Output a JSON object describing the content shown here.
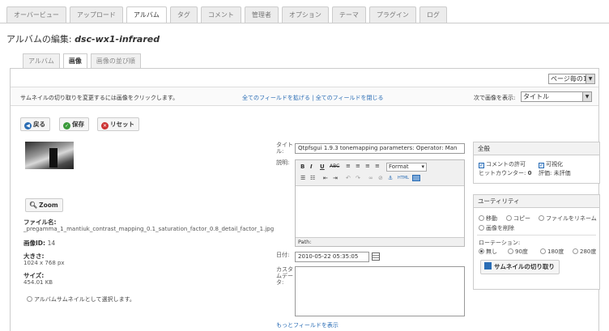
{
  "main_tabs": [
    {
      "label": "オーバービュー"
    },
    {
      "label": "アップロード"
    },
    {
      "label": "アルバム"
    },
    {
      "label": "タグ"
    },
    {
      "label": "コメント"
    },
    {
      "label": "管理者"
    },
    {
      "label": "オプション"
    },
    {
      "label": "テーマ"
    },
    {
      "label": "プラグイン"
    },
    {
      "label": "ログ"
    }
  ],
  "active_main_tab": "アルバム",
  "page": {
    "title_prefix": "アルバムの編集: ",
    "album_name": "dsc-wx1-infrared"
  },
  "sub_tabs": [
    {
      "label": "アルバム"
    },
    {
      "label": "画像"
    },
    {
      "label": "画像の並び順"
    }
  ],
  "pager": {
    "selected": "ページ毎の10"
  },
  "info_bar": {
    "hint": "サムネイルの切り取りを変更するには画像をクリックします。",
    "expand_all": "全てのフィールドを拡げる",
    "separator": " | ",
    "collapse_all": "全てのフィールドを閉じる",
    "sort_label": "次で画像を表示:",
    "sort_selected": "タイトル"
  },
  "actions": {
    "back": "戻る",
    "save": "保存",
    "reset": "リセット"
  },
  "image": {
    "zoom_label": "Zoom",
    "filename_label": "ファイル名:",
    "filename": "_pregamma_1_mantiuk_contrast_mapping_0.1_saturation_factor_0.8_detail_factor_1.jpg",
    "id_label": "画像ID:",
    "id_value": "14",
    "size_label": "大きさ:",
    "size_value": "1024 x 768 px",
    "filesize_label": "サイズ:",
    "filesize_value": "454.01 KB",
    "album_thumb_label": "アルバムサムネイルとして選択します。"
  },
  "form": {
    "title_label": "タイトル:",
    "title_value": "Qtpfsgui 1.9.3 tonemapping parameters: Operator: Man",
    "desc_label": "説明:",
    "editor_format": "Format",
    "editor_path": "Path:",
    "date_label": "日付:",
    "date_value": "2010-05-22 05:35:05",
    "custom_label": "カスタムデータ:",
    "more_fields": "もっとフィールドを表示"
  },
  "general_box": {
    "header": "全般",
    "allow_comments": "コメントの許可",
    "visible": "可視化",
    "hit_counter_label": "ヒットカウンター:",
    "hit_counter_value": "0",
    "rating_label": "評価:",
    "rating_value": "未評価"
  },
  "utility_box": {
    "header": "ユーティリティ",
    "move": "移動",
    "copy": "コピー",
    "rename": "ファイルをリネーム",
    "delete": "画像を削除",
    "rotation_label": "ローテーション:",
    "rot_none": "無し",
    "rot_90": "90度",
    "rot_180": "180度",
    "rot_270": "280度",
    "crop_button": "サムネイルの切り取り"
  }
}
